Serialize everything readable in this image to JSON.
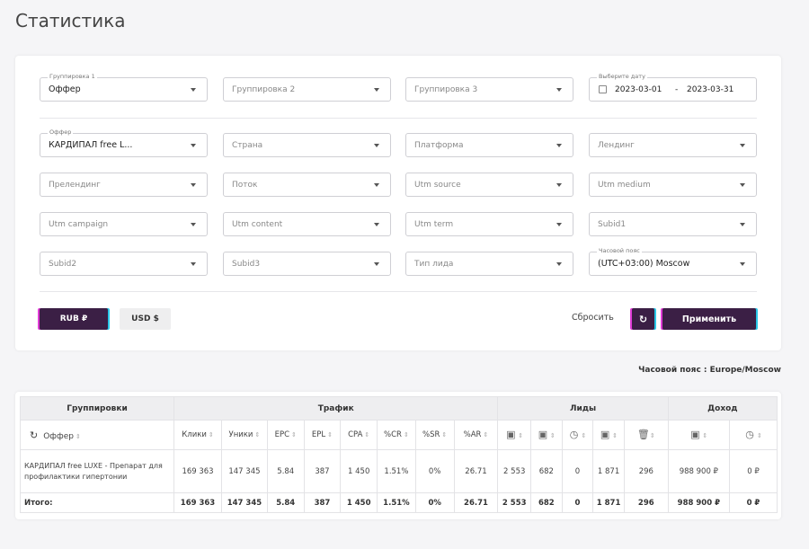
{
  "page": {
    "title": "Статистика"
  },
  "filters": {
    "grouping1": {
      "label": "Группировка 1",
      "value": "Оффер"
    },
    "grouping2": {
      "placeholder": "Группировка 2"
    },
    "grouping3": {
      "placeholder": "Группировка 3"
    },
    "date": {
      "label": "Выберите дату",
      "from": "2023-03-01",
      "sep": "-",
      "to": "2023-03-31"
    },
    "offer": {
      "label": "Оффер",
      "value": "КАРДИПАЛ free L..."
    },
    "country": {
      "placeholder": "Страна"
    },
    "platform": {
      "placeholder": "Платформа"
    },
    "landing": {
      "placeholder": "Лендинг"
    },
    "prelanding": {
      "placeholder": "Прелендинг"
    },
    "stream": {
      "placeholder": "Поток"
    },
    "utm_source": {
      "placeholder": "Utm source"
    },
    "utm_medium": {
      "placeholder": "Utm medium"
    },
    "utm_campaign": {
      "placeholder": "Utm campaign"
    },
    "utm_content": {
      "placeholder": "Utm content"
    },
    "utm_term": {
      "placeholder": "Utm term"
    },
    "subid1": {
      "placeholder": "Subid1"
    },
    "subid2": {
      "placeholder": "Subid2"
    },
    "subid3": {
      "placeholder": "Subid3"
    },
    "lead_type": {
      "placeholder": "Тип лида"
    },
    "timezone": {
      "label": "Часовой пояс",
      "value": "(UTC+03:00) Moscow"
    }
  },
  "actions": {
    "rub": "RUB ₽",
    "usd": "USD $",
    "reset": "Сбросить",
    "refresh_icon": "refresh-icon",
    "apply": "Применить"
  },
  "timezone_note": "Часовой пояс : Europe/Moscow",
  "table": {
    "groups": {
      "groupings": "Группировки",
      "traffic": "Трафик",
      "leads": "Лиды",
      "income": "Доход"
    },
    "columns": {
      "offer": "Оффер",
      "clicks": "Клики",
      "uniques": "Уники",
      "epc": "EPC",
      "epl": "EPL",
      "cpa": "CPA",
      "cr": "%CR",
      "sr": "%SR",
      "ar": "%AR"
    },
    "row": {
      "offer": "КАРДИПАЛ free LUXE - Препарат для профилактики гипертонии",
      "clicks": "169 363",
      "uniques": "147 345",
      "epc": "5.84",
      "epl": "387",
      "cpa": "1 450",
      "cr": "1.51%",
      "sr": "0%",
      "ar": "26.71",
      "leads_total": "2 553",
      "leads_approved": "682",
      "leads_hold": "0",
      "leads_rejected": "1 871",
      "leads_trash": "296",
      "income_approved": "988 900 ₽",
      "income_hold": "0 ₽"
    },
    "total": {
      "label": "Итого:",
      "clicks": "169 363",
      "uniques": "147 345",
      "epc": "5.84",
      "epl": "387",
      "cpa": "1 450",
      "cr": "1.51%",
      "sr": "0%",
      "ar": "26.71",
      "leads_total": "2 553",
      "leads_approved": "682",
      "leads_hold": "0",
      "leads_rejected": "1 871",
      "leads_trash": "296",
      "income_approved": "988 900 ₽",
      "income_hold": "0 ₽"
    },
    "sort_glyph": "⇕"
  },
  "colors": {
    "primary": "#3b1f45",
    "approved": "#3bb54a",
    "hold": "#f5a623",
    "rejected": "#e74c3c"
  }
}
